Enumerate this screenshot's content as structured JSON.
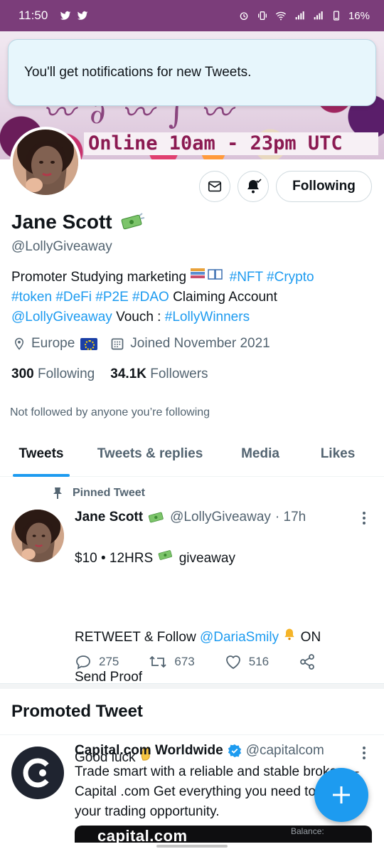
{
  "status_bar": {
    "time": "11:50",
    "battery": "16%"
  },
  "banner": {
    "schedule_text": "Online 10am - 23pm UTC"
  },
  "toast": {
    "message": "You'll get notifications for new Tweets."
  },
  "profile": {
    "following_button": "Following",
    "name": "Jane Scott",
    "handle": "@LollyGiveaway",
    "bio": {
      "p1": "Promoter Studying marketing ",
      "tags1": "#NFT #Crypto",
      "tags2": "#token #DeFi #P2E #DAO",
      "p2": " Claiming Account",
      "mention": "@LollyGiveaway",
      "p3": " Vouch : ",
      "tag3": "#LollyWinners"
    },
    "location": "Europe",
    "joined": "Joined November 2021",
    "following_count": "300",
    "following_label": "Following",
    "followers_count": "34.1K",
    "followers_label": "Followers",
    "not_followed_text": "Not followed by anyone you’re following"
  },
  "tabs": [
    {
      "label": "Tweets",
      "active": true
    },
    {
      "label": "Tweets & replies",
      "active": false
    },
    {
      "label": "Media",
      "active": false
    },
    {
      "label": "Likes",
      "active": false
    }
  ],
  "pinned_tweet": {
    "pinned_label": "Pinned Tweet",
    "author_name": "Jane Scott",
    "author_handle": "@LollyGiveaway",
    "time": "· 17h",
    "line1": "$10 • 12HRS ",
    "line1b": " giveaway",
    "line2a": "RETWEET & Follow ",
    "mention": "@DariaSmily",
    "line2b": " ON",
    "line3": "Send Proof",
    "line4": "Good luck ",
    "replies": "275",
    "retweets": "673",
    "likes": "516"
  },
  "promoted": {
    "section_title": "Promoted Tweet",
    "author_name": "Capital.com Worldwide",
    "author_handle": "@capitalcom",
    "body": "Trade smart with a reliable and stable broker — Capital .com Get everything you need to seize your trading opportunity.",
    "card_brand": "capital.com",
    "card_balance_label": "Balance:"
  },
  "colors": {
    "accent": "#1d9bf0",
    "status_bar": "#7b3d7a",
    "banner_text": "#8b1a52"
  }
}
